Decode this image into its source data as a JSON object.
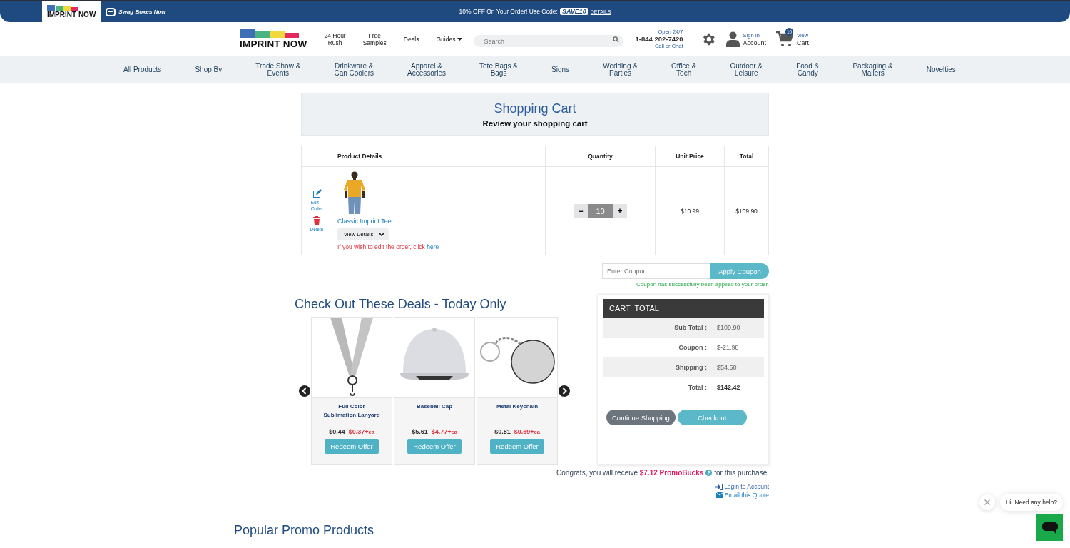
{
  "top_banner": {
    "tabs": [
      {
        "label": "IMPRINT NOW",
        "selected": true
      },
      {
        "label": "Swag Boxes Now",
        "selected": false
      }
    ],
    "promo_text": "10% OFF On Your Order! Use Code:",
    "promo_code": "SAVE10",
    "details_link": "DETAILS"
  },
  "header": {
    "logo": "IMPRINT NOW",
    "links": [
      {
        "lines": [
          "24 Hour",
          "Rush"
        ]
      },
      {
        "lines": [
          "Free",
          "Samples"
        ]
      },
      {
        "lines": [
          "Deals"
        ]
      }
    ],
    "guides": "Guides",
    "search": {
      "placeholder": "Search"
    },
    "phone": {
      "hours": "Open 24/7",
      "number": "1-844 202-7420",
      "call": "Call or",
      "chat": "Chat"
    },
    "account": {
      "top": "Sign In",
      "bottom": "Account"
    },
    "cart": {
      "badge": "10",
      "top": "View",
      "bottom": "Cart"
    }
  },
  "nav": [
    {
      "lines": [
        "All Products"
      ]
    },
    {
      "lines": [
        "Shop By"
      ]
    },
    {
      "lines": [
        "Trade Show &",
        "Events"
      ]
    },
    {
      "lines": [
        "Drinkware &",
        "Can Coolers"
      ]
    },
    {
      "lines": [
        "Apparel &",
        "Accessories"
      ]
    },
    {
      "lines": [
        "Tote Bags &",
        "Bags"
      ]
    },
    {
      "lines": [
        "Signs"
      ]
    },
    {
      "lines": [
        "Wedding &",
        "Parties"
      ]
    },
    {
      "lines": [
        "Office &",
        "Tech"
      ]
    },
    {
      "lines": [
        "Outdoor &",
        "Leisure"
      ]
    },
    {
      "lines": [
        "Food &",
        "Candy"
      ]
    },
    {
      "lines": [
        "Packaging &",
        "Mailers"
      ]
    },
    {
      "lines": [
        "Novelties"
      ]
    }
  ],
  "page_header": {
    "title": "Shopping Cart",
    "subtitle": "Review your shopping cart"
  },
  "table": {
    "columns": [
      "Product Details",
      "Quantity",
      "Unit Price",
      "Total"
    ],
    "rows": [
      {
        "edit": [
          "Edit",
          "Order"
        ],
        "delete": "Delete",
        "image": {
          "kind": "picture"
        },
        "name": "Classic Imprint Tee",
        "details_button": "View Details",
        "note": "If you wish to edit the order, click",
        "note_link": "here",
        "quantity": "10",
        "minus": "−",
        "plus": "+",
        "unit_price": "$10.99",
        "total": "$109.90"
      }
    ]
  },
  "coupon": {
    "placeholder": "Enter Coupon",
    "button": "Apply Coupon",
    "message": "Coupon has successfully been applied to your order."
  },
  "deals": {
    "title": "Check Out These Deals - Today Only",
    "items": [
      {
        "kind": "lanyard",
        "name": [
          "Full Color",
          "Sublimation Lanyard"
        ],
        "old_price": "$0.44",
        "price": "$0.37+",
        "unit": "ea",
        "button": "Redeem Offer"
      },
      {
        "kind": "cap",
        "name": [
          "Baseball Cap"
        ],
        "old_price": "$5.61",
        "price": "$4.77+",
        "unit": "ea",
        "button": "Redeem Offer"
      },
      {
        "kind": "keychain",
        "name": [
          "Metal Keychain"
        ],
        "old_price": "$0.81",
        "price": "$0.69+",
        "unit": "ea",
        "button": "Redeem Offer"
      }
    ]
  },
  "cart_total": {
    "title": "CART  TOTAL",
    "rows": [
      {
        "label": "Sub Total :",
        "value": "$109.90",
        "bold": false
      },
      {
        "label": "Coupon :",
        "value": "$-21.98",
        "bold": false
      },
      {
        "label": "Shipping :",
        "value": "$54.50",
        "bold": false
      },
      {
        "label": "Total :",
        "value": "$142.42",
        "bold": true
      }
    ],
    "continue": "Continue Shopping",
    "checkout": "Checkout"
  },
  "promobucks": {
    "message": "Congrats, you will receive **$7.12 PromoBucks**",
    "message_end": "for this purchase."
  },
  "links": [
    {
      "kind": "login",
      "label": "Login to Account"
    },
    {
      "kind": "email",
      "label": "Email this Quote"
    }
  ],
  "popular_title": "Popular Promo Products",
  "chat": {
    "message": "Hi. Need any help?"
  }
}
